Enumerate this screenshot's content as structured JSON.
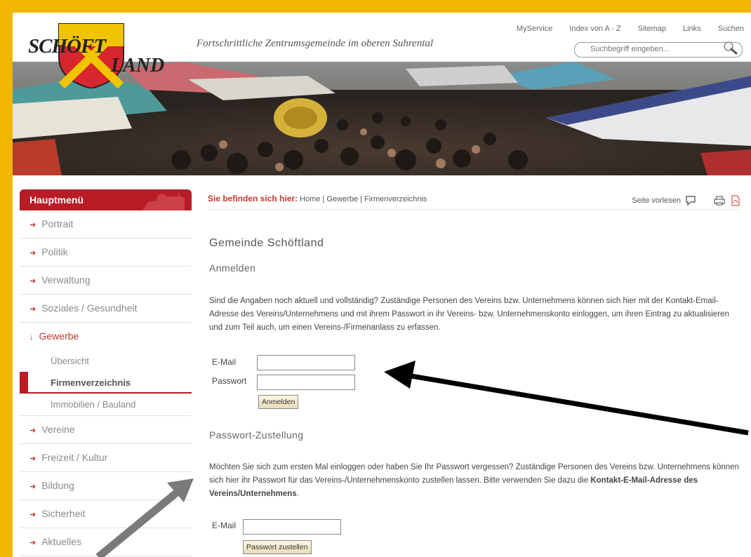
{
  "header": {
    "logo_top": "SCHÖFT",
    "logo_bottom": "LAND",
    "tagline": "Fortschrittliche Zentrumsgemeinde im oberen Suhrental",
    "topnav": [
      "MyService",
      "Index von A - Z",
      "Sitemap",
      "Links",
      "Suchen"
    ],
    "search_placeholder": "Suchbegriff eingeben..."
  },
  "sidebar": {
    "title": "Hauptmenü",
    "items_top": [
      "Portrait",
      "Politik",
      "Verwaltung",
      "Soziales / Gesundheit"
    ],
    "open_item": "Gewerbe",
    "subitems": [
      "Übersicht",
      "Firmenverzeichnis",
      "Immobilien / Bauland"
    ],
    "items_bottom": [
      "Vereine",
      "Freizeit / Kultur",
      "Bildung",
      "Sicherheit",
      "Aktuelles"
    ]
  },
  "breadcrumb": {
    "label": "Sie befinden sich hier:",
    "items": [
      "Home",
      "Gewerbe",
      "Firmenverzeichnis"
    ],
    "sep": "|"
  },
  "tools": {
    "read_aloud": "Seite vorlesen"
  },
  "content": {
    "title": "Gemeinde Schöftland",
    "login_heading": "Anmelden",
    "login_text": "Sind die Angaben noch aktuell und vollständig? Zuständige Personen des Vereins bzw. Unternehmens können sich hier mit der Kontakt-Email-Adresse des Vereins/Unternehmens und mit ihrem Passwort in ihr Vereins- bzw. Unternehmenskonto einloggen, um ihren Eintrag zu aktualisieren und zum Teil auch, um einen Vereins-/Firmenanlass zu erfassen.",
    "email_label": "E-Mail",
    "password_label": "Passwort",
    "login_button": "Anmelden",
    "reset_heading": "Passwort-Zustellung",
    "reset_text": "Möchten Sie sich zum ersten Mal einloggen oder haben Sie Ihr Passwort vergessen? Zuständige Personen des Vereins bzw. Unternehmens können sich hier ihr Passwort für das Vereins-/Unternehmenskonto zustellen lassen. Bitte verwenden Sie dazu die",
    "reset_text_bold": "Kontakt-E-Mail-Adresse des Vereins/Unternehmens",
    "reset_text_end": ".",
    "reset_email_label": "E-Mail",
    "reset_button": "Passwort zustellen"
  },
  "colors": {
    "frame": "#f2b600",
    "accent": "#b81c25"
  }
}
